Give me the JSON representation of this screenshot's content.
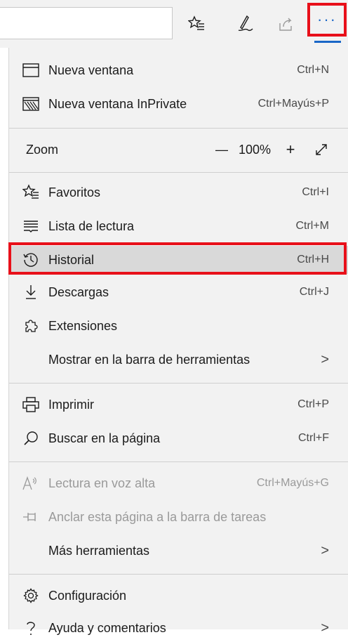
{
  "toolbar": {
    "address_value": "",
    "icons": [
      "favorites-star-icon",
      "pen-icon",
      "share-icon"
    ],
    "more_label": "···"
  },
  "menu": {
    "new_window": {
      "label": "Nueva ventana",
      "shortcut": "Ctrl+N"
    },
    "new_inprivate": {
      "label": "Nueva ventana InPrivate",
      "shortcut": "Ctrl+Mayús+P"
    },
    "zoom": {
      "label": "Zoom",
      "minus": "—",
      "value": "100%",
      "plus": "+"
    },
    "favorites": {
      "label": "Favoritos",
      "shortcut": "Ctrl+I"
    },
    "reading_list": {
      "label": "Lista de lectura",
      "shortcut": "Ctrl+M"
    },
    "history": {
      "label": "Historial",
      "shortcut": "Ctrl+H"
    },
    "downloads": {
      "label": "Descargas",
      "shortcut": "Ctrl+J"
    },
    "extensions": {
      "label": "Extensiones"
    },
    "show_toolbar": {
      "label": "Mostrar en la barra de herramientas",
      "chevron": ">"
    },
    "print": {
      "label": "Imprimir",
      "shortcut": "Ctrl+P"
    },
    "find": {
      "label": "Buscar en la página",
      "shortcut": "Ctrl+F"
    },
    "read_aloud": {
      "label": "Lectura en voz alta",
      "shortcut": "Ctrl+Mayús+G"
    },
    "pin_taskbar": {
      "label": "Anclar esta página a la barra de tareas"
    },
    "more_tools": {
      "label": "Más herramientas",
      "chevron": ">"
    },
    "settings": {
      "label": "Configuración"
    },
    "help": {
      "label": "Ayuda y comentarios",
      "chevron": ">"
    }
  },
  "colors": {
    "accent": "#1a67c7",
    "annotation_red": "#e8101a",
    "menu_bg": "#f2f2f2",
    "hover_bg": "#d9d9d9"
  }
}
